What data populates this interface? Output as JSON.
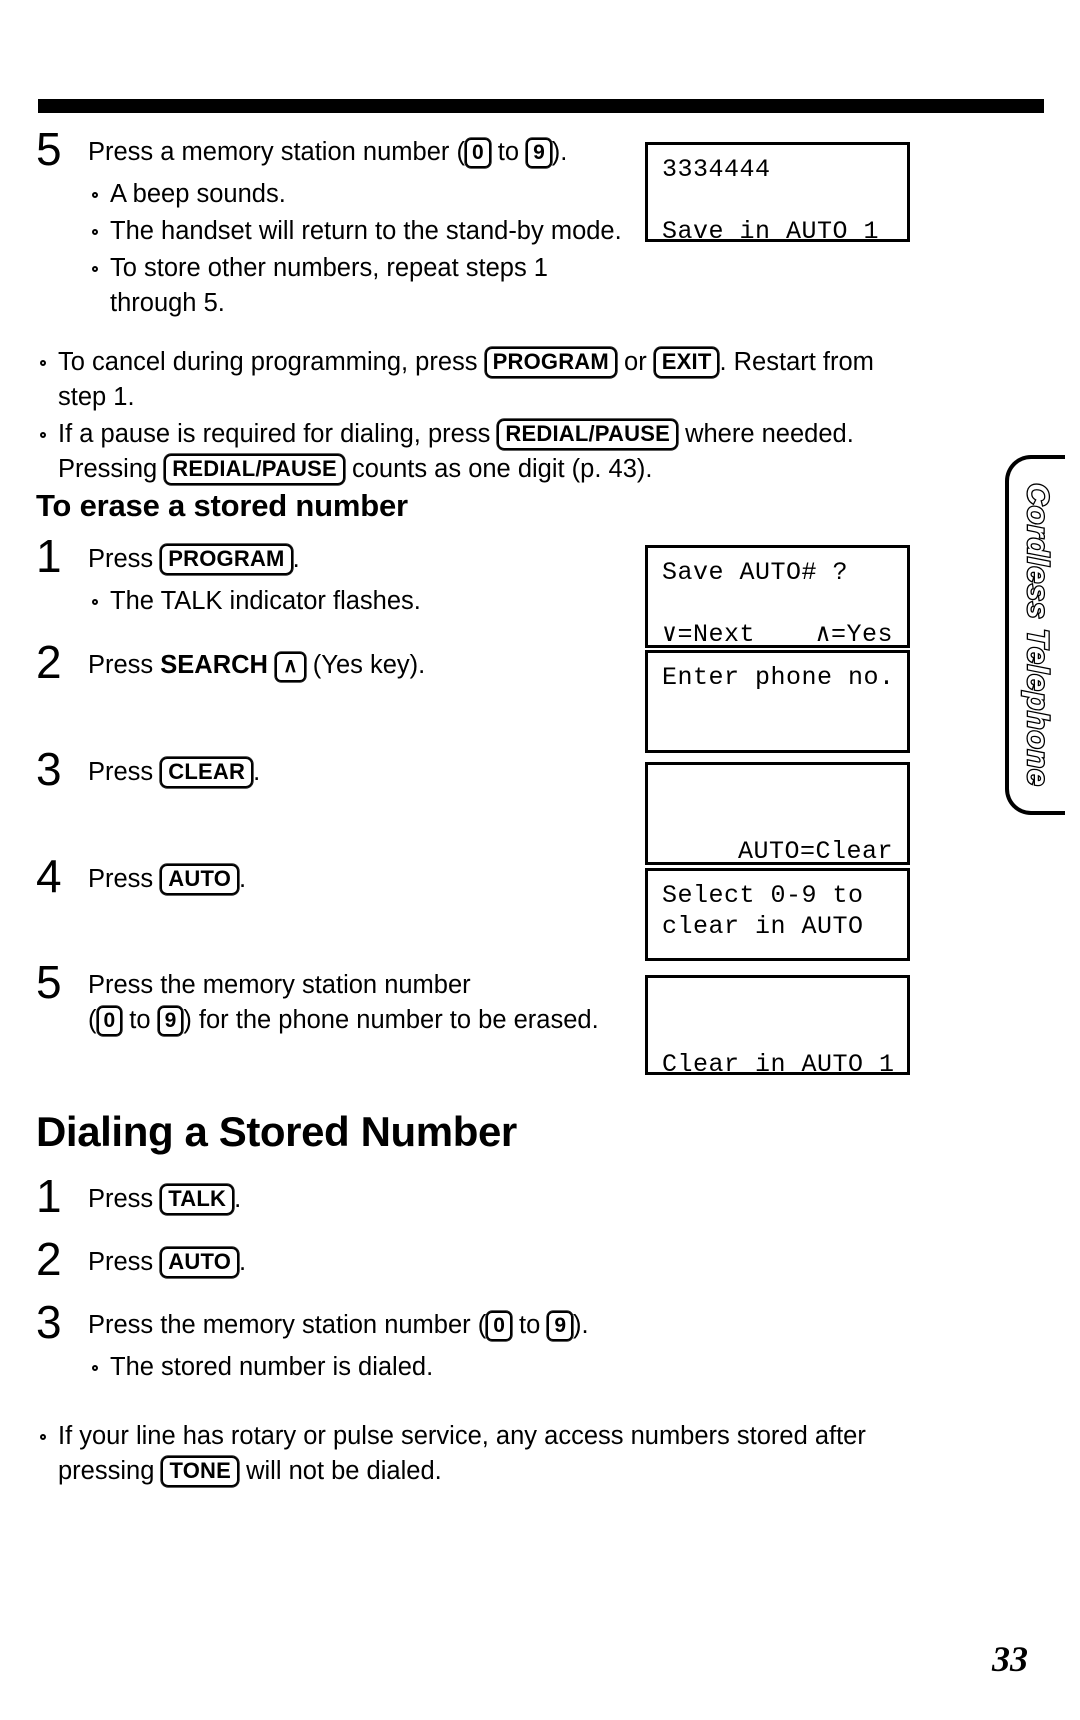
{
  "page": {
    "number": "33",
    "side_tab_label": "Cordless Telephone"
  },
  "section_store": {
    "step5": {
      "number": "5",
      "text_before": "Press a memory station number (",
      "key_from": "0",
      "text_mid": " to ",
      "key_to": "9",
      "text_after": ").",
      "bullets": [
        "A beep sounds.",
        "The handset will return to the stand-by mode.",
        "To store other numbers, repeat steps 1 through 5."
      ]
    },
    "notes": [
      {
        "parts": [
          "To cancel during programming, press ",
          "PROGRAM",
          " or ",
          "EXIT",
          ". Restart from step 1."
        ]
      },
      {
        "parts": [
          "If a pause is required for dialing, press ",
          "REDIAL/PAUSE",
          " where needed. Pressing ",
          "REDIAL/PAUSE",
          " counts as one digit (p. 43)."
        ]
      }
    ],
    "lcd": {
      "line1": "3334444",
      "line2": "Save in AUTO 1"
    }
  },
  "section_erase": {
    "heading": "To erase a stored number",
    "steps": [
      {
        "number": "1",
        "text_before": "Press ",
        "key": "PROGRAM",
        "text_after": ".",
        "bullets": [
          "The TALK indicator flashes."
        ]
      },
      {
        "number": "2",
        "text_before": "Press ",
        "label_bold": "SEARCH",
        "key_arrow": "∧",
        "text_after": " (Yes key)."
      },
      {
        "number": "3",
        "text_before": "Press ",
        "key": "CLEAR",
        "text_after": "."
      },
      {
        "number": "4",
        "text_before": "Press ",
        "key": "AUTO",
        "text_after": "."
      },
      {
        "number": "5",
        "text_line1": "Press the memory station number",
        "text_open": "(",
        "key_from": "0",
        "text_mid": " to ",
        "key_to": "9",
        "text_line2_after": ") for the phone number to be erased."
      }
    ],
    "lcds": [
      {
        "line1": "Save AUTO# ?",
        "line2": "",
        "line3_left": "∨=Next",
        "line3_right": "∧=Yes"
      },
      {
        "line1": "Enter phone no.",
        "line2": "",
        "line3": ""
      },
      {
        "line1": "",
        "line2": "",
        "line3_right": "AUTO=Clear"
      },
      {
        "line1": "Select 0-9 to",
        "line2": "clear in AUTO",
        "line3": ""
      },
      {
        "line1": "",
        "line2": "",
        "line3_right": "Clear in AUTO 1"
      }
    ]
  },
  "section_dial": {
    "heading": "Dialing a Stored Number",
    "steps": [
      {
        "number": "1",
        "text_before": "Press ",
        "key": "TALK",
        "text_after": "."
      },
      {
        "number": "2",
        "text_before": "Press ",
        "key": "AUTO",
        "text_after": "."
      },
      {
        "number": "3",
        "text_before": "Press the memory station number (",
        "key_from": "0",
        "text_mid": " to ",
        "key_to": "9",
        "text_after": ").",
        "bullets": [
          "The stored number is dialed."
        ]
      }
    ],
    "note": {
      "text_before": "If your line has rotary or pulse service, any access numbers stored after pressing ",
      "key": "TONE",
      "text_after": " will not be dialed."
    }
  }
}
